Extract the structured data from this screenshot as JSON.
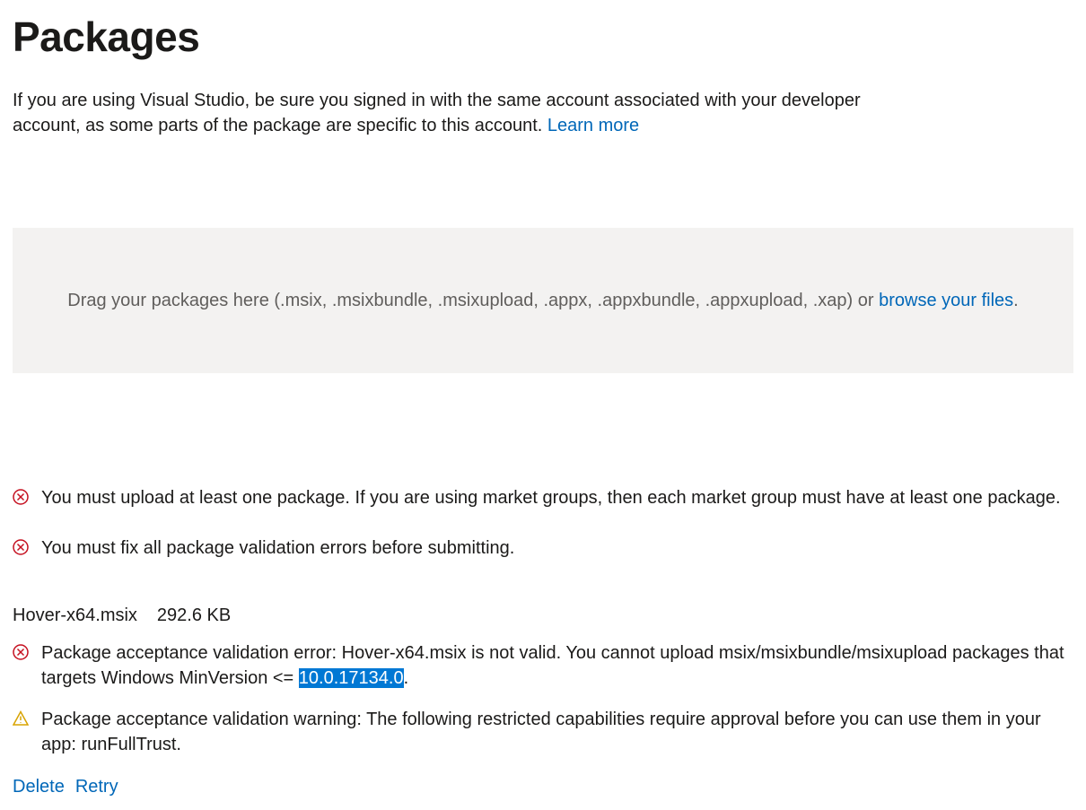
{
  "header": {
    "title": "Packages"
  },
  "intro": {
    "text": "If you are using Visual Studio, be sure you signed in with the same account associated with your developer account, as some parts of the package are specific to this account. ",
    "learn_more": "Learn more"
  },
  "dropzone": {
    "text_before": "Drag your packages here (.msix, .msixbundle, .msixupload, .appx, .appxbundle, .appxupload, .xap) or ",
    "browse_link": "browse your files",
    "text_after": "."
  },
  "global_errors": [
    {
      "text": "You must upload at least one package. If you are using market groups, then each market group must have at least one package."
    },
    {
      "text": "You must fix all package validation errors before submitting."
    }
  ],
  "file": {
    "name": "Hover-x64.msix",
    "size": "292.6 KB",
    "messages": [
      {
        "type": "error",
        "text_before": "Package acceptance validation error: Hover-x64.msix is not valid. You cannot upload msix/msixbundle/msixupload packages that targets Windows MinVersion <= ",
        "highlighted": "10.0.17134.0",
        "text_after": "."
      },
      {
        "type": "warning",
        "text": "Package acceptance validation warning: The following restricted capabilities require approval before you can use them in your app: runFullTrust."
      }
    ],
    "actions": {
      "delete": "Delete",
      "retry": "Retry"
    }
  }
}
